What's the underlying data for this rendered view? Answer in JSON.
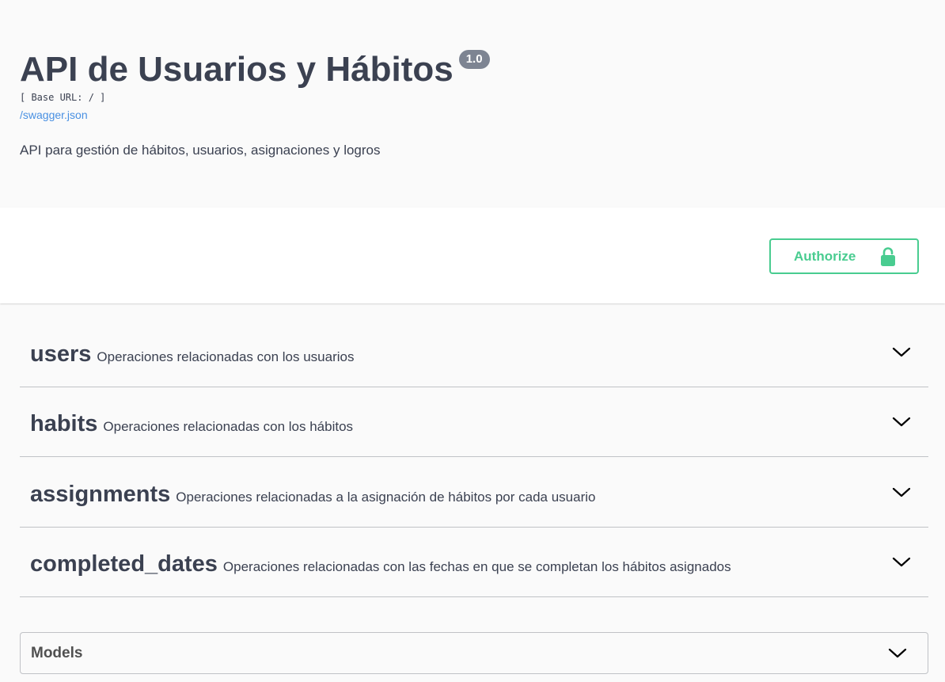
{
  "info": {
    "title": "API de Usuarios y Hábitos",
    "version": "1.0",
    "base_url": "[ Base URL: / ]",
    "spec_link": "/swagger.json",
    "description": "API para gestión de hábitos, usuarios, asignaciones y logros"
  },
  "auth": {
    "authorize_label": "Authorize",
    "icon": "unlock-icon",
    "color": "#49cc90"
  },
  "tags": [
    {
      "name": "users",
      "description": "Operaciones relacionadas con los usuarios",
      "icon": "chevron-down-icon"
    },
    {
      "name": "habits",
      "description": "Operaciones relacionadas con los hábitos",
      "icon": "chevron-down-icon"
    },
    {
      "name": "assignments",
      "description": "Operaciones relacionadas a la asignación de hábitos por cada usuario",
      "icon": "chevron-down-icon"
    },
    {
      "name": "completed_dates",
      "description": "Operaciones relacionadas con las fechas en que se completan los hábitos asignados",
      "icon": "chevron-down-icon"
    }
  ],
  "models": {
    "title": "Models",
    "icon": "chevron-down-icon"
  },
  "colors": {
    "text": "#3b4151",
    "link": "#4990e2",
    "badge": "#7d8492",
    "accent": "#49cc90",
    "background": "#fafafa"
  }
}
